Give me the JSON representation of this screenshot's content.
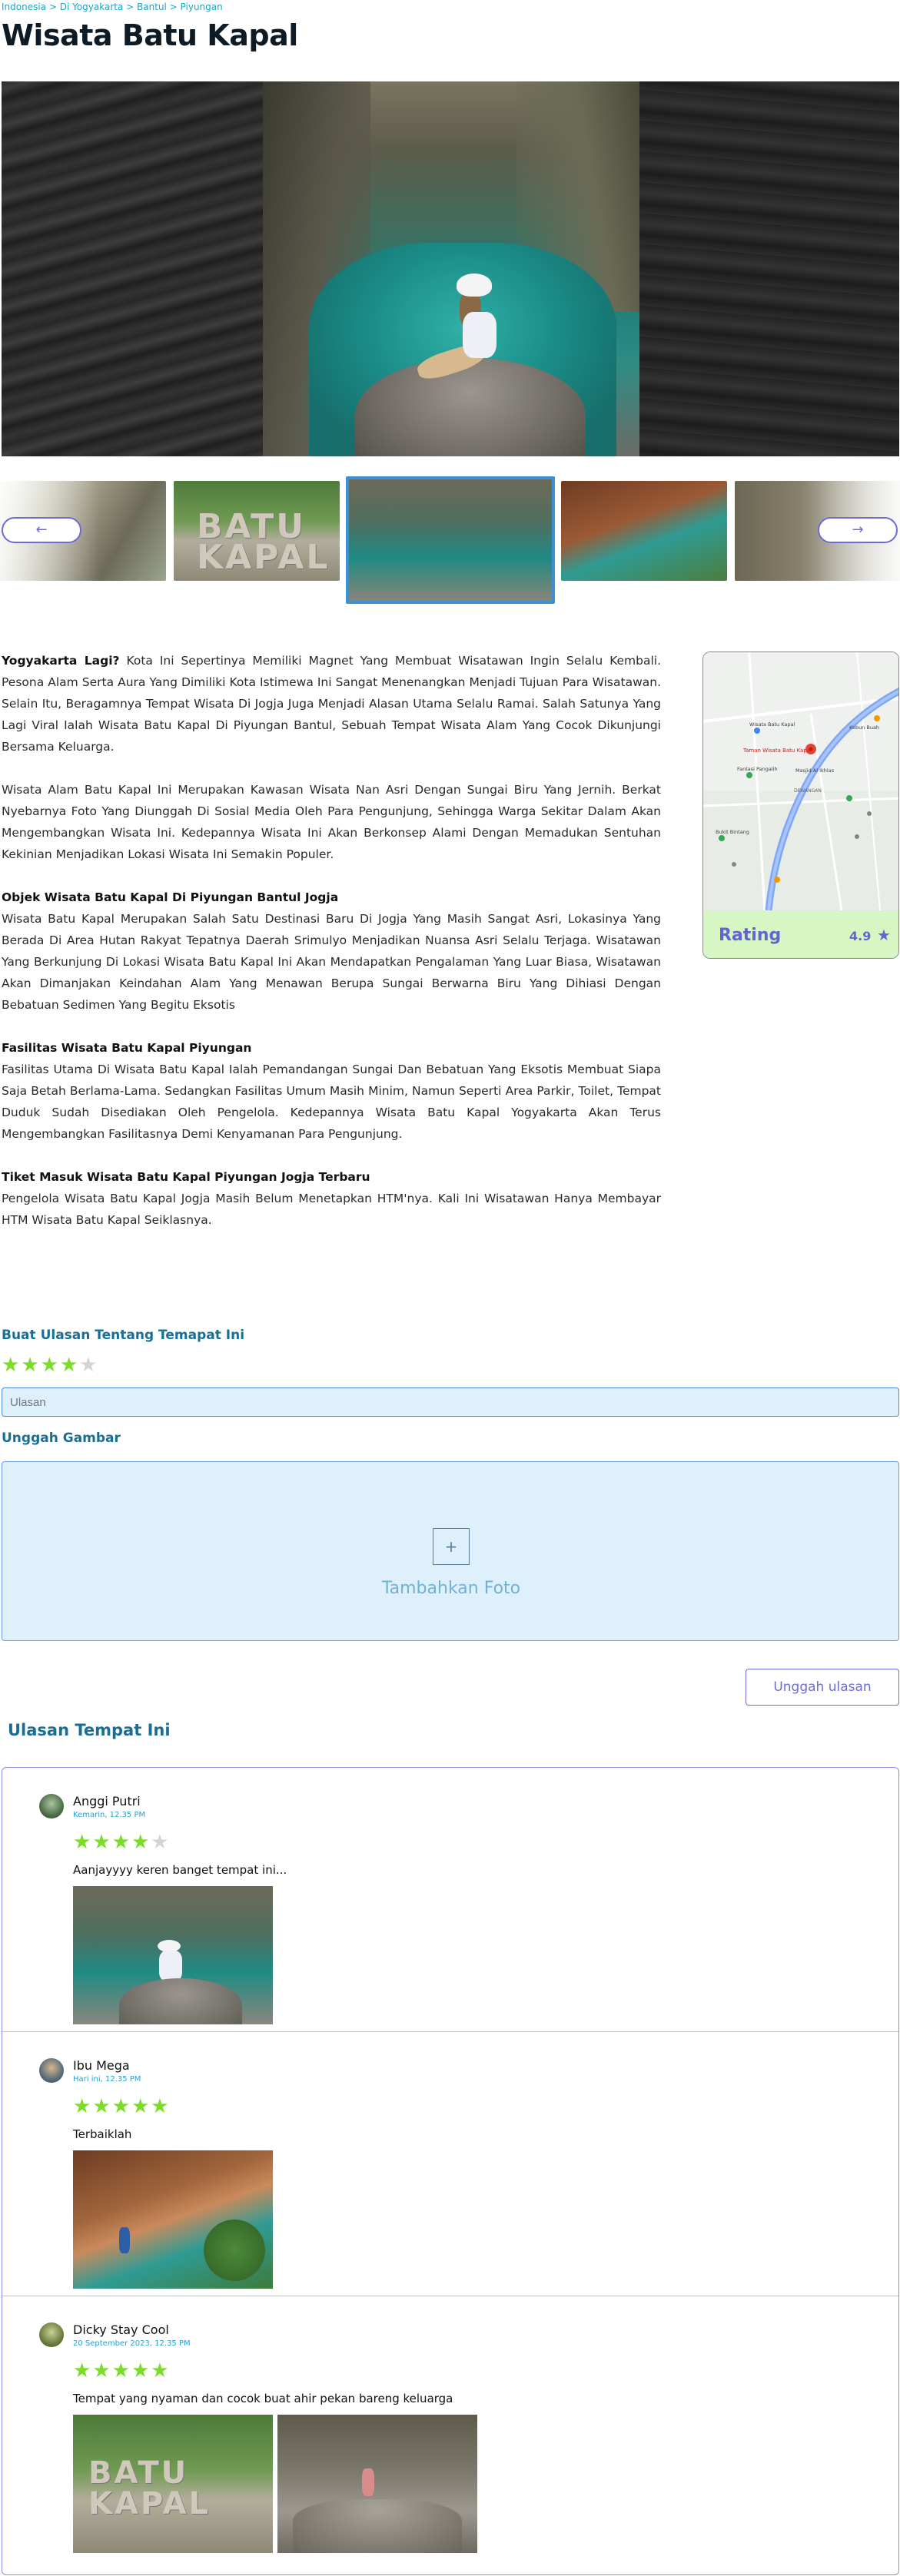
{
  "breadcrumb": "Indonesia > Di Yogyakarta > Bantul > Piyungan",
  "title": "Wisata Batu Kapal",
  "gallery": {
    "prev_icon": "arrow-left-icon",
    "next_icon": "arrow-right-icon",
    "prev_glyph": "←",
    "next_glyph": "→",
    "thumb_text": "BATU KAPAL"
  },
  "article": {
    "p1_lead": "Yogyakarta Lagi?",
    "p1_body": " Kota Ini Sepertinya Memiliki Magnet Yang Membuat Wisatawan Ingin Selalu Kembali. Pesona Alam Serta Aura Yang Dimiliki Kota Istimewa Ini Sangat Menenangkan Menjadi Tujuan Para Wisatawan. Selain Itu, Beragamnya Tempat Wisata Di Jogja Juga Menjadi Alasan Utama Selalu Ramai. Salah Satunya Yang Lagi Viral Ialah Wisata Batu Kapal Di Piyungan Bantul, Sebuah Tempat Wisata Alam Yang Cocok Dikunjungi Bersama Keluarga.",
    "p2": "Wisata Alam Batu Kapal Ini Merupakan Kawasan Wisata Nan Asri Dengan Sungai Biru Yang Jernih. Berkat Nyebarnya Foto Yang Diunggah Di Sosial Media Oleh Para Pengunjung, Sehingga Warga Sekitar Dalam Akan Mengembangkan Wisata Ini. Kedepannya Wisata Ini Akan Berkonsep Alami Dengan Memadukan Sentuhan Kekinian Menjadikan Lokasi Wisata Ini Semakin Populer.",
    "h3": "Objek Wisata Batu Kapal Di Piyungan Bantul Jogja",
    "p3": "Wisata Batu Kapal Merupakan Salah Satu Destinasi Baru Di Jogja Yang Masih Sangat Asri, Lokasinya Yang Berada Di Area Hutan Rakyat Tepatnya Daerah Srimulyo Menjadikan Nuansa Asri Selalu Terjaga. Wisatawan Yang Berkunjung Di Lokasi Wisata Batu Kapal Ini Akan Mendapatkan Pengalaman Yang Luar Biasa, Wisatawan Akan Dimanjakan Keindahan Alam Yang Menawan Berupa Sungai Berwarna Biru Yang Dihiasi Dengan Bebatuan Sedimen Yang Begitu Eksotis",
    "h4": "Fasilitas Wisata Batu Kapal Piyungan",
    "p4": "Fasilitas Utama Di Wisata Batu Kapal Ialah Pemandangan Sungai Dan Bebatuan Yang Eksotis Membuat Siapa Saja Betah Berlama-Lama. Sedangkan Fasilitas Umum Masih Minim, Namun Seperti Area Parkir, Toilet, Tempat Duduk Sudah Disediakan Oleh Pengelola. Kedepannya Wisata Batu Kapal Yogyakarta Akan Terus Mengembangkan Fasilitasnya Demi Kenyamanan Para Pengunjung.",
    "h5": "Tiket Masuk Wisata Batu Kapal Piyungan Jogja Terbaru",
    "p5": "Pengelola Wisata Batu Kapal Jogja Masih Belum Menetapkan HTM'nya. Kali Ini Wisatawan Hanya Membayar HTM Wisata Batu Kapal Seiklasnya."
  },
  "map": {
    "labels": {
      "pin": "Taman Wisata Batu Kapal",
      "poi1": "Wisata Batu Kapal",
      "poi2": "Fantasi Pangalih",
      "poi3": "Bukit Bintang",
      "poi4": "Masjid Al Ikhlas",
      "poi5": "Kebun Buah",
      "area": "DEWANGAN"
    },
    "colors": {
      "road": "#7ea8f5",
      "pin": "#ea4335"
    }
  },
  "rating": {
    "label": "Rating",
    "value": "4.9",
    "icon": "star-icon",
    "glyph": "★"
  },
  "review_form": {
    "title": "Buat Ulasan Tentang Temapat Ini",
    "stars": [
      true,
      true,
      true,
      true,
      false
    ],
    "star_glyph": "★",
    "input_placeholder": "Ulasan",
    "upload_title": "Unggah Gambar",
    "upload_plus": "+",
    "upload_label": "Tambahkan Foto",
    "submit_label": "Unggah ulasan"
  },
  "reviews": {
    "title": "Ulasan Tempat Ini",
    "items": [
      {
        "name": "Anggi Putri",
        "date": "Kemarin, 12.35 PM",
        "stars": [
          true,
          true,
          true,
          true,
          false
        ],
        "text": "Aanjayyyy keren banget tempat ini..."
      },
      {
        "name": "Ibu Mega",
        "date": "Hari ini, 12.35 PM",
        "stars": [
          true,
          true,
          true,
          true,
          true
        ],
        "text": "Terbaiklah"
      },
      {
        "name": "Dicky Stay Cool",
        "date": "20 September 2023, 12.35 PM",
        "stars": [
          true,
          true,
          true,
          true,
          true
        ],
        "text": "Tempat yang nyaman dan cocok buat ahir pekan bareng keluarga"
      }
    ]
  },
  "colors": {
    "accent": "#6d6bd6",
    "heading": "#1a6e94",
    "star_on": "#7bdc2a",
    "star_off": "#d4d4d4",
    "rating_bg": "#d6f7c4",
    "form_bg": "#dff0fd"
  }
}
